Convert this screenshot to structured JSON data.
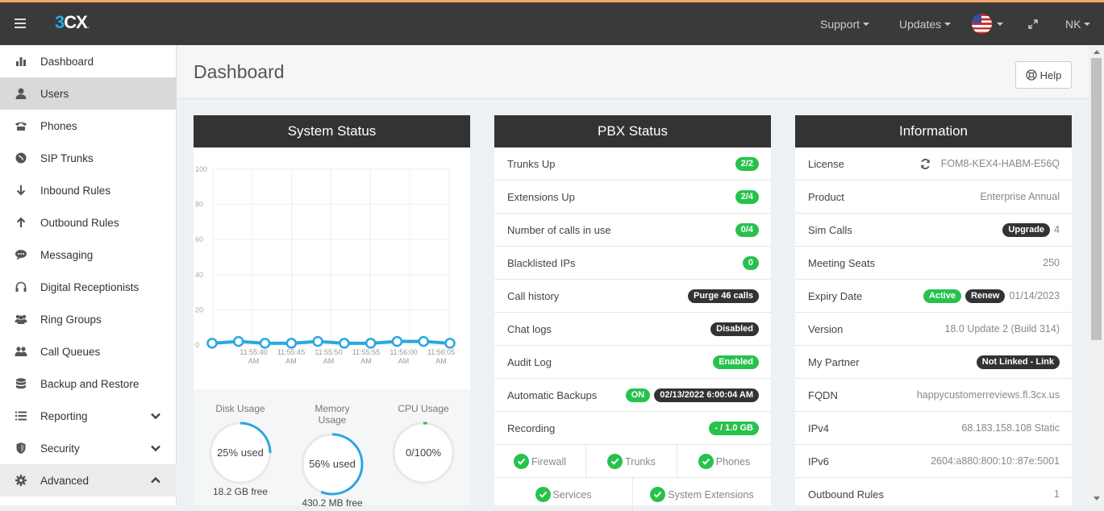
{
  "app": {
    "logo_text": "3CX"
  },
  "topbar": {
    "support": "Support",
    "updates": "Updates",
    "user": "NK"
  },
  "sidebar": {
    "items": [
      {
        "label": "Dashboard",
        "icon": "bar-chart-icon"
      },
      {
        "label": "Users",
        "icon": "user-icon"
      },
      {
        "label": "Phones",
        "icon": "phone-icon"
      },
      {
        "label": "SIP Trunks",
        "icon": "globe-icon"
      },
      {
        "label": "Inbound Rules",
        "icon": "arrow-down-icon"
      },
      {
        "label": "Outbound Rules",
        "icon": "arrow-up-icon"
      },
      {
        "label": "Messaging",
        "icon": "chat-icon"
      },
      {
        "label": "Digital Receptionists",
        "icon": "headset-icon"
      },
      {
        "label": "Ring Groups",
        "icon": "group-icon"
      },
      {
        "label": "Call Queues",
        "icon": "users-icon"
      },
      {
        "label": "Backup and Restore",
        "icon": "database-icon"
      },
      {
        "label": "Reporting",
        "icon": "list-icon"
      },
      {
        "label": "Security",
        "icon": "shield-icon"
      },
      {
        "label": "Advanced",
        "icon": "gear-icon"
      }
    ]
  },
  "page": {
    "title": "Dashboard",
    "help": "Help"
  },
  "system_status": {
    "title": "System Status",
    "disk": {
      "title": "Disk Usage",
      "value": "25% used",
      "sub": "18.2 GB free",
      "fraction": 0.25
    },
    "memory": {
      "title": "Memory Usage",
      "value": "56% used",
      "sub": "430.2 MB free",
      "fraction": 0.56
    },
    "cpu": {
      "title": "CPU Usage",
      "value": "0/100%",
      "fraction": 0.02
    }
  },
  "chart_data": {
    "type": "line",
    "yticks": [
      "100",
      "80",
      "60",
      "40",
      "20",
      "0"
    ],
    "ylim": [
      0,
      100
    ],
    "x": [
      "11:55:40 AM",
      "11:55:45 AM",
      "11:55:50 AM",
      "11:55:55 AM",
      "11:56:00 AM",
      "11:56:05 AM"
    ],
    "xtick_lines": [
      [
        "11:55:40",
        "AM"
      ],
      [
        "11:55:45",
        "AM"
      ],
      [
        "11:55:50",
        "AM"
      ],
      [
        "11:55:55",
        "AM"
      ],
      [
        "11:56:00",
        "AM"
      ],
      [
        "11:56:05",
        "AM"
      ]
    ],
    "values": [
      1,
      2,
      1,
      1,
      2,
      1,
      1,
      2,
      2,
      1
    ],
    "color": "#2aa7e0"
  },
  "pbx_status": {
    "title": "PBX Status",
    "rows": [
      {
        "label": "Trunks Up",
        "badge": "2/2",
        "color": "green"
      },
      {
        "label": "Extensions Up",
        "badge": "2/4",
        "color": "green"
      },
      {
        "label": "Number of calls in use",
        "badge": "0/4",
        "color": "green"
      },
      {
        "label": "Blacklisted IPs",
        "badge": "0",
        "color": "green"
      },
      {
        "label": "Call history",
        "badge": "Purge 46 calls",
        "color": "dark"
      },
      {
        "label": "Chat logs",
        "badge": "Disabled",
        "color": "dark"
      },
      {
        "label": "Audit Log",
        "badge": "Enabled",
        "color": "green"
      },
      {
        "label": "Automatic Backups",
        "badge": "ON",
        "badge2": "02/13/2022 6:00:04 AM",
        "color": "green"
      },
      {
        "label": "Recording",
        "badge": "- / 1.0 GB",
        "color": "green"
      }
    ],
    "checks_row1": [
      "Firewall",
      "Trunks",
      "Phones"
    ],
    "checks_row2": [
      "Services",
      "System Extensions"
    ]
  },
  "information": {
    "title": "Information",
    "rows": [
      {
        "label": "License",
        "value": "FOM8-KEX4-HABM-E56Q"
      },
      {
        "label": "Product",
        "value": "Enterprise Annual"
      },
      {
        "label": "Sim Calls",
        "badge": "Upgrade",
        "value": "4"
      },
      {
        "label": "Meeting Seats",
        "value": "250"
      },
      {
        "label": "Expiry Date",
        "badge_active": "Active",
        "badge_renew": "Renew",
        "value": "01/14/2023"
      },
      {
        "label": "Version",
        "value": "18.0 Update 2 (Build 314)"
      },
      {
        "label": "My Partner",
        "badge": "Not Linked - Link"
      },
      {
        "label": "FQDN",
        "value": "happycustomerreviews.fl.3cx.us"
      },
      {
        "label": "IPv4",
        "value": "68.183.158.108 Static"
      },
      {
        "label": "IPv6",
        "value": "2604:a880:800:10::87e:5001"
      },
      {
        "label": "Outbound Rules",
        "value": "1"
      }
    ]
  }
}
